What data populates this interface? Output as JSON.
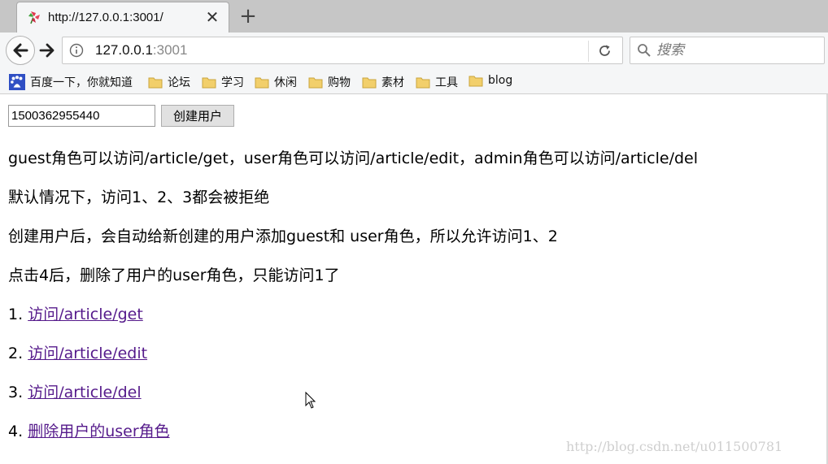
{
  "browser": {
    "tab": {
      "title": "http://127.0.0.1:3001/",
      "close_glyph": "✕",
      "favicon": "pinwheel-icon"
    },
    "new_tab_glyph": "+",
    "url": {
      "host": "127.0.0.1",
      "port": ":3001"
    },
    "search": {
      "placeholder": "搜索"
    },
    "bookmarks": [
      {
        "label": "百度一下，你就知道",
        "icon": "baidu-paw-icon"
      },
      {
        "label": "论坛",
        "icon": "folder-icon"
      },
      {
        "label": "学习",
        "icon": "folder-icon"
      },
      {
        "label": "休闲",
        "icon": "folder-icon"
      },
      {
        "label": "购物",
        "icon": "folder-icon"
      },
      {
        "label": "素材",
        "icon": "folder-icon"
      },
      {
        "label": "工具",
        "icon": "folder-icon"
      },
      {
        "label": "blog",
        "icon": "folder-icon"
      }
    ]
  },
  "page": {
    "user_id_value": "1500362955440",
    "create_button_label": "创建用户",
    "paragraphs": [
      "guest角色可以访问/article/get，user角色可以访问/article/edit，admin角色可以访问/article/del",
      "默认情况下，访问1、2、3都会被拒绝",
      "创建用户后，会自动给新创建的用户添加guest和 user角色，所以允许访问1、2",
      "点击4后，删除了用户的user角色，只能访问1了"
    ],
    "links": [
      {
        "number": "1.",
        "label": "访问/article/get"
      },
      {
        "number": "2.",
        "label": "访问/article/edit"
      },
      {
        "number": "3.",
        "label": "访问/article/del"
      },
      {
        "number": "4.",
        "label": "删除用户的user角色"
      }
    ],
    "watermark": "http://blog.csdn.net/u011500781"
  },
  "colors": {
    "link_visited": "#551a8b",
    "chrome_bg": "#f5f6f7",
    "tabstrip_bg": "#c6c6c6"
  }
}
